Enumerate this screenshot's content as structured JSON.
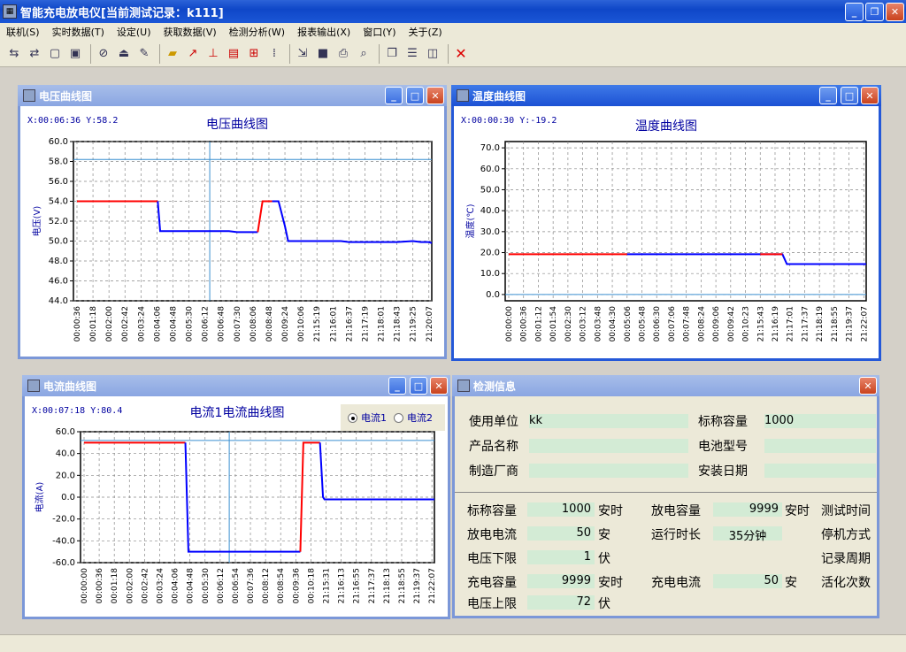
{
  "window": {
    "title": "智能充电放电仪[当前测试记录：k111]",
    "icon": "app-icon"
  },
  "menu": [
    "联机(S)",
    "实时数据(T)",
    "设定(U)",
    "获取数据(V)",
    "检测分析(W)",
    "报表输出(X)",
    "窗口(Y)",
    "关于(Z)"
  ],
  "toolbar_icons": [
    "connect-icon",
    "disconnect-icon",
    "copy-icon",
    "stack-icon",
    "attach-icon",
    "upload-icon",
    "settings-icon",
    "open-folder-icon",
    "marker-icon",
    "edit-icon",
    "chart-table-icon",
    "grid-icon",
    "grid-dotted-icon",
    "export-icon",
    "fill-icon",
    "print-icon",
    "preview-icon",
    "cascade-icon",
    "tile-horizontal-icon",
    "tile-vertical-icon",
    "close-red-icon"
  ],
  "voltage": {
    "window_title": "电压曲线图",
    "coord": "X:00:06:36 Y:58.2",
    "chart_data": {
      "type": "line",
      "title": "电压曲线图",
      "ylabel": "电压(V)",
      "ylim": [
        44,
        60
      ],
      "yticks": [
        "60.0",
        "58.0",
        "56.0",
        "54.0",
        "52.0",
        "50.0",
        "48.0",
        "46.0",
        "44.0"
      ],
      "xticks": [
        "00:00:36",
        "00:01:18",
        "00:02:00",
        "00:02:42",
        "00:03:24",
        "00:04:06",
        "00:04:48",
        "00:05:30",
        "00:06:12",
        "00:06:48",
        "00:07:30",
        "00:08:06",
        "00:08:48",
        "00:09:24",
        "00:10:06",
        "21:15:19",
        "21:16:01",
        "21:16:37",
        "21:17:19",
        "21:18:01",
        "21:18:43",
        "21:19:25",
        "21:20:07"
      ],
      "cursor": {
        "x_index": 8.3,
        "y": 58.2
      },
      "series": [
        {
          "color": "#ff0000",
          "points": [
            [
              0,
              54
            ],
            [
              5.05,
              54
            ]
          ]
        },
        {
          "color": "#0000ff",
          "points": [
            [
              5.05,
              54
            ],
            [
              5.2,
              51
            ],
            [
              9.5,
              51
            ],
            [
              10.0,
              50.9
            ],
            [
              11.3,
              50.9
            ]
          ]
        },
        {
          "color": "#ff0000",
          "points": [
            [
              11.3,
              50.9
            ],
            [
              11.6,
              54
            ],
            [
              12.2,
              54
            ]
          ]
        },
        {
          "color": "#0000ff",
          "points": [
            [
              12.2,
              54
            ],
            [
              12.6,
              54
            ],
            [
              13,
              51.5
            ],
            [
              13.2,
              50
            ],
            [
              16.5,
              50
            ],
            [
              17,
              49.9
            ],
            [
              20,
              49.9
            ],
            [
              21,
              50
            ],
            [
              21.5,
              49.9
            ],
            [
              22,
              49.9
            ],
            [
              22.4,
              49.8
            ]
          ]
        }
      ]
    }
  },
  "temperature": {
    "window_title": "温度曲线图",
    "coord": "X:00:00:30 Y:-19.2",
    "chart_data": {
      "type": "line",
      "title": "温度曲线图",
      "ylabel": "温度(℃)",
      "ylim": [
        -3,
        73
      ],
      "yticks": [
        "70.0",
        "60.0",
        "50.0",
        "40.0",
        "30.0",
        "20.0",
        "10.0",
        "0.0"
      ],
      "ytick_values": [
        70,
        60,
        50,
        40,
        30,
        20,
        10,
        0
      ],
      "xticks": [
        "00:00:00",
        "00:00:36",
        "00:01:12",
        "00:01:54",
        "00:02:30",
        "00:03:12",
        "00:03:48",
        "00:04:30",
        "00:05:06",
        "00:05:48",
        "00:06:30",
        "00:07:06",
        "00:07:48",
        "00:08:24",
        "00:09:06",
        "00:09:42",
        "00:10:23",
        "21:15:43",
        "21:16:19",
        "21:17:01",
        "21:17:37",
        "21:18:19",
        "21:18:55",
        "21:19:37",
        "21:22:07"
      ],
      "cursor": {
        "x_index": 28.6,
        "y": 0
      },
      "series": [
        {
          "color": "#ff0000",
          "points": [
            [
              0,
              19.2
            ],
            [
              8,
              19.2
            ]
          ]
        },
        {
          "color": "#0000ff",
          "points": [
            [
              8,
              19.2
            ],
            [
              18.5,
              19.2
            ],
            [
              18.8,
              14.5
            ],
            [
              28.6,
              14.5
            ]
          ]
        },
        {
          "color": "#ff0000",
          "points": [
            [
              17,
              19.2
            ],
            [
              18.5,
              19.2
            ]
          ]
        }
      ]
    }
  },
  "current": {
    "window_title": "电流曲线图",
    "coord": "X:00:07:18 Y:80.4",
    "radio": [
      {
        "label": "电流1",
        "selected": true
      },
      {
        "label": "电流2",
        "selected": false
      }
    ],
    "chart_data": {
      "type": "line",
      "title": "电流1电流曲线图",
      "ylabel": "电流(A)",
      "ylim": [
        -60,
        60
      ],
      "yticks": [
        "60.0",
        "40.0",
        "20.0",
        "0.0",
        "-20.0",
        "-40.0",
        "-60.0"
      ],
      "xticks": [
        "00:00:00",
        "00:00:36",
        "00:01:18",
        "00:02:00",
        "00:02:42",
        "00:03:24",
        "00:04:06",
        "00:04:48",
        "00:05:30",
        "00:06:12",
        "00:06:54",
        "00:07:36",
        "00:08:12",
        "00:08:54",
        "00:09:36",
        "00:10:18",
        "21:15:31",
        "21:16:13",
        "21:16:55",
        "21:17:37",
        "21:18:13",
        "21:18:55",
        "21:19:37",
        "21:22:07"
      ],
      "cursor": {
        "x_index": 9.6,
        "y": 52
      },
      "series": [
        {
          "color": "#ff0000",
          "points": [
            [
              0,
              50
            ],
            [
              6.7,
              50
            ]
          ]
        },
        {
          "color": "#0000ff",
          "points": [
            [
              6.7,
              50
            ],
            [
              6.8,
              0
            ],
            [
              6.9,
              -50
            ],
            [
              14.3,
              -50
            ]
          ]
        },
        {
          "color": "#ff0000",
          "points": [
            [
              14.3,
              -50
            ],
            [
              14.4,
              0
            ],
            [
              14.5,
              50
            ],
            [
              15.6,
              50
            ]
          ]
        },
        {
          "color": "#0000ff",
          "points": [
            [
              15.6,
              50
            ],
            [
              15.8,
              0
            ],
            [
              15.9,
              -2
            ],
            [
              24,
              -2
            ]
          ]
        }
      ]
    }
  },
  "info": {
    "window_title": "检测信息",
    "top": {
      "use_unit_label": "使用单位",
      "use_unit_value": "kk",
      "nominal_cap_label": "标称容量",
      "nominal_cap_value": "1000",
      "product_label": "产品名称",
      "product_value": "",
      "battery_type_label": "电池型号",
      "battery_type_value": "",
      "maker_label": "制造厂商",
      "maker_value": "",
      "install_label": "安装日期",
      "install_value": ""
    },
    "bottom": {
      "nominal_cap_label": "标称容量",
      "nominal_cap_value": "1000",
      "nominal_cap_unit": "安时",
      "discharge_cap_label": "放电容量",
      "discharge_cap_value": "9999",
      "discharge_cap_unit": "安时",
      "test_time_label": "测试时间",
      "discharge_cur_label": "放电电流",
      "discharge_cur_value": "50",
      "discharge_cur_unit": "安",
      "run_time_label": "运行时长",
      "run_time_value": "35分钟",
      "stop_mode_label": "停机方式",
      "volt_low_label": "电压下限",
      "volt_low_value": "1",
      "volt_low_unit": "伏",
      "record_period_label": "记录周期",
      "charge_cap_label": "充电容量",
      "charge_cap_value": "9999",
      "charge_cap_unit": "安时",
      "charge_cur_label": "充电电流",
      "charge_cur_value": "50",
      "charge_cur_unit": "安",
      "activate_label": "活化次数",
      "volt_high_label": "电压上限",
      "volt_high_value": "72",
      "volt_high_unit": "伏"
    }
  }
}
